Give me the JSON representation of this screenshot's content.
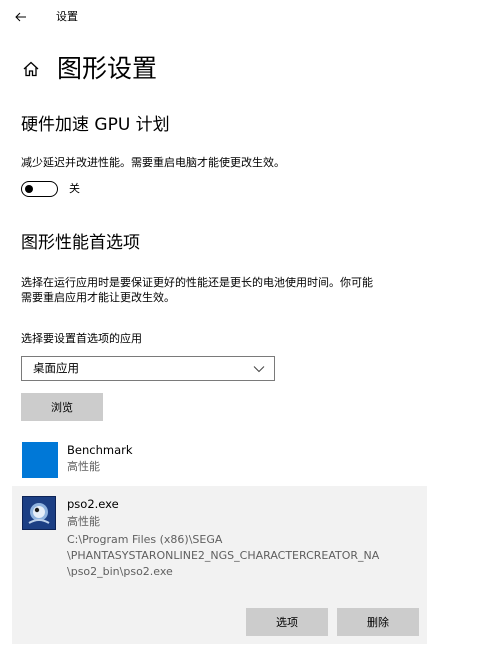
{
  "window": {
    "title": "设置"
  },
  "header": {
    "title": "图形设置"
  },
  "hardware_section": {
    "title": "硬件加速 GPU 计划",
    "description": "减少延迟并改进性能。需要重启电脑才能使更改生效。",
    "toggle_state": "关"
  },
  "preference_section": {
    "title": "图形性能首选项",
    "description_line1": "选择在运行应用时是要保证更好的性能还是更长的电池使用时间。你可能",
    "description_line2": "需要重启应用才能让更改生效。",
    "select_label": "选择要设置首选项的应用",
    "select_value": "桌面应用",
    "browse_label": "浏览"
  },
  "apps": [
    {
      "name": "Benchmark",
      "preference": "高性能",
      "icon": "blue-square-app-icon"
    },
    {
      "name": "pso2.exe",
      "preference": "高性能",
      "path_line1": "C:\\Program Files (x86)\\SEGA",
      "path_line2": "\\PHANTASYSTARONLINE2_NGS_CHARACTERCREATOR_NA",
      "path_line3": "\\pso2_bin\\pso2.exe",
      "icon": "pso2-app-icon",
      "options_label": "选项",
      "delete_label": "删除"
    }
  ],
  "colors": {
    "accent": "#0078d7",
    "button_bg": "#cccccc",
    "selected_bg": "#f2f2f2",
    "secondary_text": "#5f5f5f"
  }
}
